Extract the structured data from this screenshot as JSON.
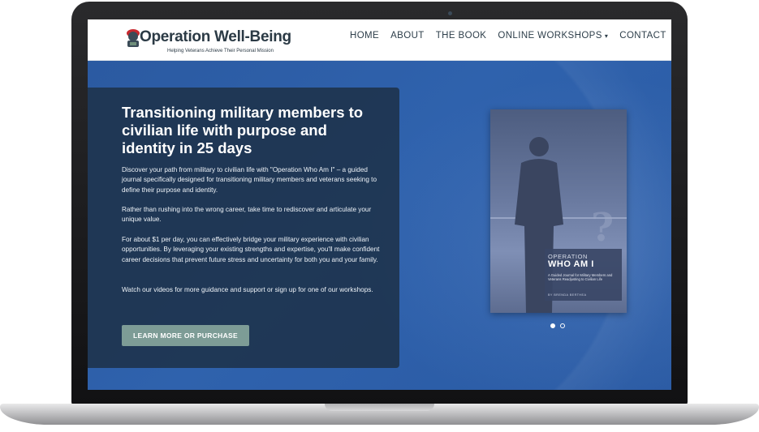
{
  "header": {
    "logo_title": "Operation Well-Being",
    "logo_tagline": "Helping Veterans Achieve Their Personal Mission",
    "nav": [
      {
        "label": "HOME",
        "active": true
      },
      {
        "label": "ABOUT"
      },
      {
        "label": "THE BOOK"
      },
      {
        "label": "ONLINE WORKSHOPS"
      },
      {
        "label": "CONTACT"
      }
    ]
  },
  "hero": {
    "title": "Transitioning military members to civilian life with purpose and identity in 25 days",
    "paragraphs": [
      "Discover your path from military to civilian life with \"Operation Who Am I\" – a guided journal specifically designed for transitioning military members and veterans seeking to define their purpose and identity.",
      "Rather than rushing into the wrong career, take time to rediscover and articulate your unique value.",
      "For about $1 per day, you can effectively bridge your military experience with civilian opportunities. By leveraging your existing strengths and expertise, you'll make confident career decisions that prevent future stress and uncertainty for both you and your family.",
      "Watch our videos for more guidance and support or sign up for one of our workshops."
    ],
    "cta_label": "LEARN MORE OR PURCHASE"
  },
  "book": {
    "title_small": "OPERATION",
    "title_big": "WHO AM I",
    "subtitle": "A Guided Journal for Military Members and Veterans Readjusting to Civilian Life",
    "author": "BY BRENDA BERTHEA"
  },
  "carousel": {
    "slide_count": 2,
    "active_index": 0
  },
  "colors": {
    "accent_button": "#7d9c96",
    "hero_blue": "#2c5ea4",
    "card_navy": "#1e344e",
    "logo_red": "#c8282e"
  }
}
